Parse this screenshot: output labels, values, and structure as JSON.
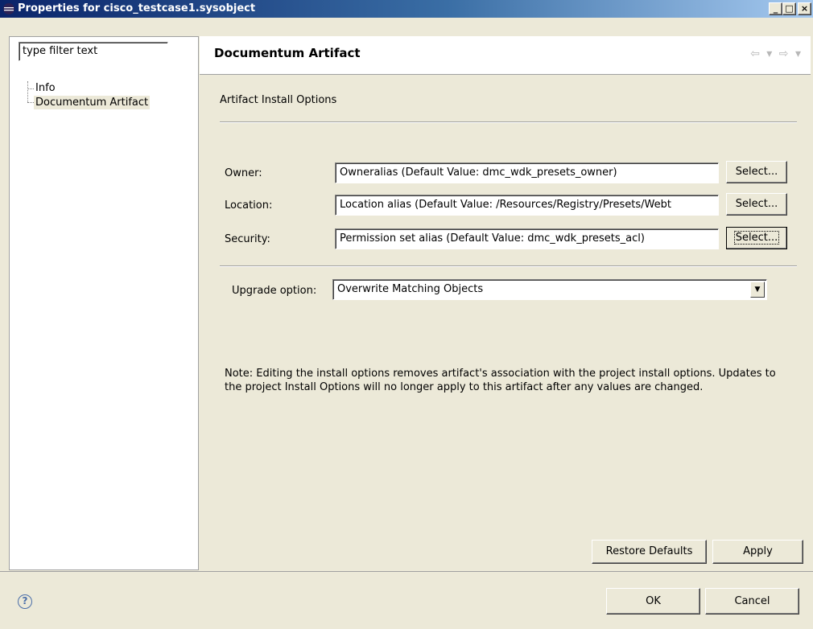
{
  "window": {
    "title": "Properties for cisco_testcase1.sysobject",
    "controls": {
      "minimize": "_",
      "maximize": "□",
      "close": "×"
    }
  },
  "tree": {
    "filter_placeholder": "type filter text",
    "items": [
      {
        "label": "Info"
      },
      {
        "label": "Documentum Artifact",
        "selected": true
      }
    ]
  },
  "page": {
    "title": "Documentum Artifact",
    "nav": {
      "back": "⇦",
      "forward": "⇨",
      "dropdown": "▾"
    },
    "section_label": "Artifact Install Options",
    "fields": {
      "owner": {
        "label": "Owner:",
        "value": "Owneralias (Default Value: dmc_wdk_presets_owner)",
        "button": "Select..."
      },
      "location": {
        "label": "Location:",
        "value": "Location alias (Default Value: /Resources/Registry/Presets/Webt",
        "button": "Select..."
      },
      "security": {
        "label": "Security:",
        "value": "Permission set alias (Default Value: dmc_wdk_presets_acl)",
        "button": "Select..."
      }
    },
    "upgrade": {
      "label": "Upgrade option:",
      "value": "Overwrite Matching Objects"
    },
    "note": "Note: Editing the install options removes artifact's association with the project install options. Updates to the project Install Options will no longer apply to this artifact after any values are changed.",
    "buttons": {
      "restore_defaults": "Restore Defaults",
      "apply": "Apply"
    }
  },
  "dialog": {
    "help": "?",
    "ok": "OK",
    "cancel": "Cancel"
  },
  "colors": {
    "titlebar_start": "#0a246a",
    "titlebar_end": "#a6caf0",
    "dialog_bg": "#ece9d8"
  }
}
